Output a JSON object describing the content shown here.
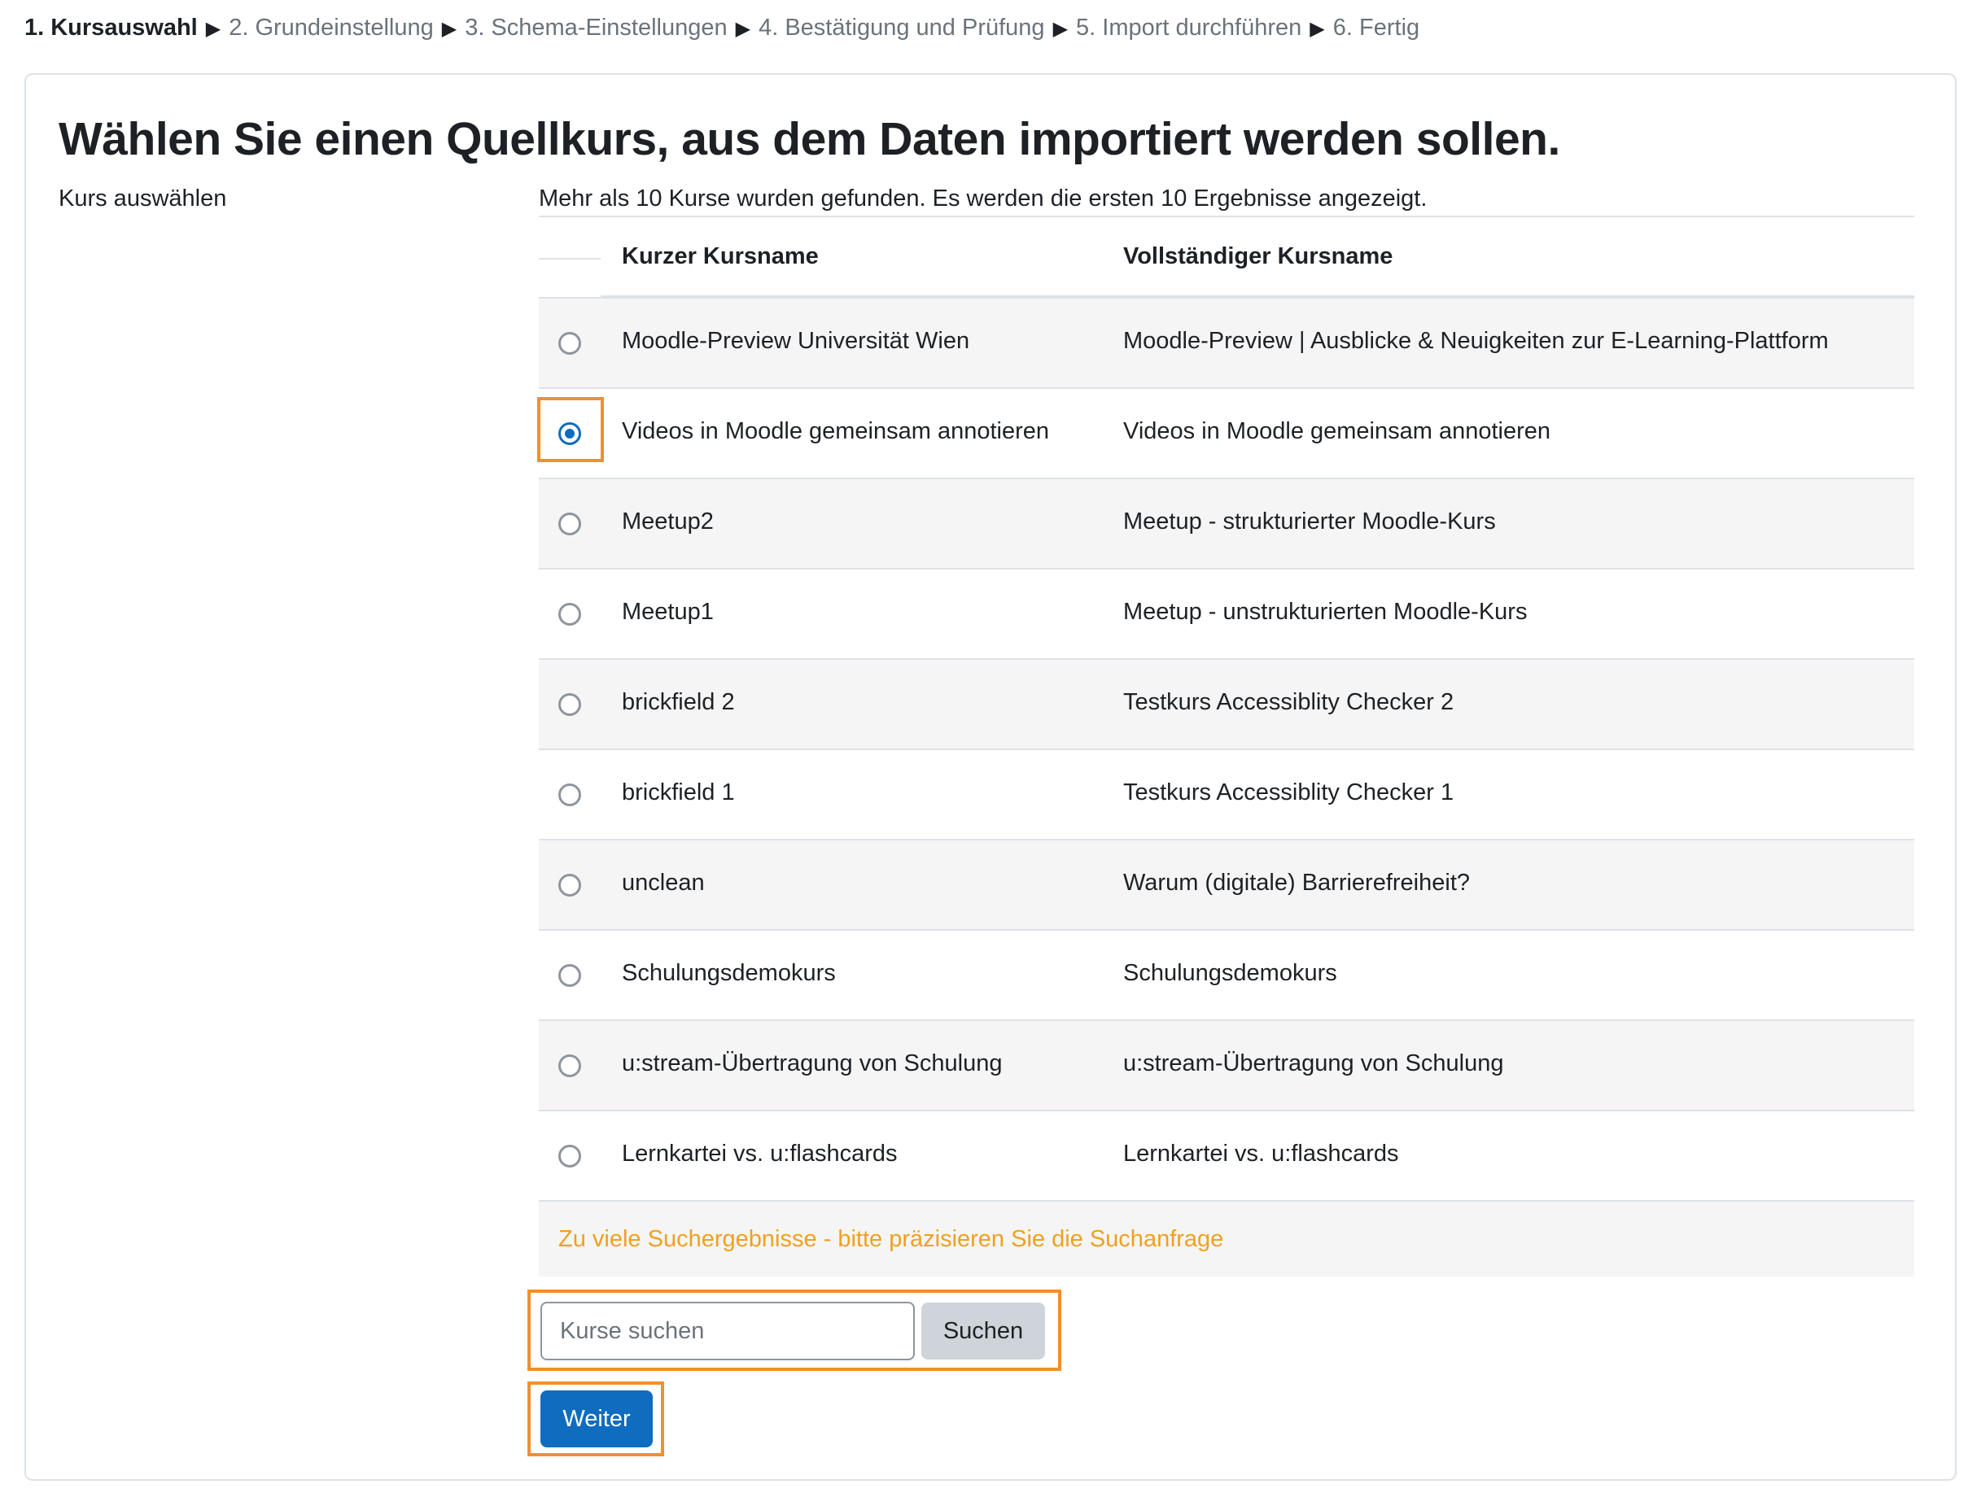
{
  "steps": [
    {
      "label": "1. Kursauswahl",
      "current": true
    },
    {
      "label": "2. Grundeinstellung",
      "current": false
    },
    {
      "label": "3. Schema-Einstellungen",
      "current": false
    },
    {
      "label": "4. Bestätigung und Prüfung",
      "current": false
    },
    {
      "label": "5. Import durchführen",
      "current": false
    },
    {
      "label": "6. Fertig",
      "current": false
    }
  ],
  "step_separator": "▶",
  "page_title": "Wählen Sie einen Quellkurs, aus dem Daten importiert werden sollen.",
  "field_label": "Kurs auswählen",
  "info_text": "Mehr als 10 Kurse wurden gefunden. Es werden die ersten 10 Ergebnisse angezeigt.",
  "table": {
    "headers": {
      "short_name": "Kurzer Kursname",
      "full_name": "Vollständiger Kursname"
    },
    "rows": [
      {
        "short_name": "Moodle-Preview Universität Wien",
        "full_name": "Moodle-Preview | Ausblicke & Neuigkeiten zur E-Learning-Plattform",
        "selected": false
      },
      {
        "short_name": "Videos in Moodle gemeinsam annotieren",
        "full_name": "Videos in Moodle gemeinsam annotieren",
        "selected": true
      },
      {
        "short_name": "Meetup2",
        "full_name": "Meetup - strukturierter Moodle-Kurs",
        "selected": false
      },
      {
        "short_name": "Meetup1",
        "full_name": "Meetup - unstrukturierten Moodle-Kurs",
        "selected": false
      },
      {
        "short_name": "brickfield 2",
        "full_name": "Testkurs Accessiblity Checker 2",
        "selected": false
      },
      {
        "short_name": "brickfield 1",
        "full_name": "Testkurs Accessiblity Checker 1",
        "selected": false
      },
      {
        "short_name": "unclean",
        "full_name": "Warum (digitale) Barrierefreiheit?",
        "selected": false
      },
      {
        "short_name": "Schulungsdemokurs",
        "full_name": "Schulungsdemokurs",
        "selected": false
      },
      {
        "short_name": "u:stream-Übertragung von Schulung",
        "full_name": "u:stream-Übertragung von Schulung",
        "selected": false
      },
      {
        "short_name": "Lernkartei vs. u:flashcards",
        "full_name": "Lernkartei vs. u:flashcards",
        "selected": false
      }
    ],
    "warning": "Zu viele Suchergebnisse - bitte präzisieren Sie die Suchanfrage"
  },
  "search": {
    "placeholder": "Kurse suchen",
    "value": "",
    "button_label": "Suchen"
  },
  "next_button_label": "Weiter",
  "colors": {
    "primary": "#0f6cbf",
    "highlight": "#f0902c",
    "warning": "#f0a020"
  }
}
